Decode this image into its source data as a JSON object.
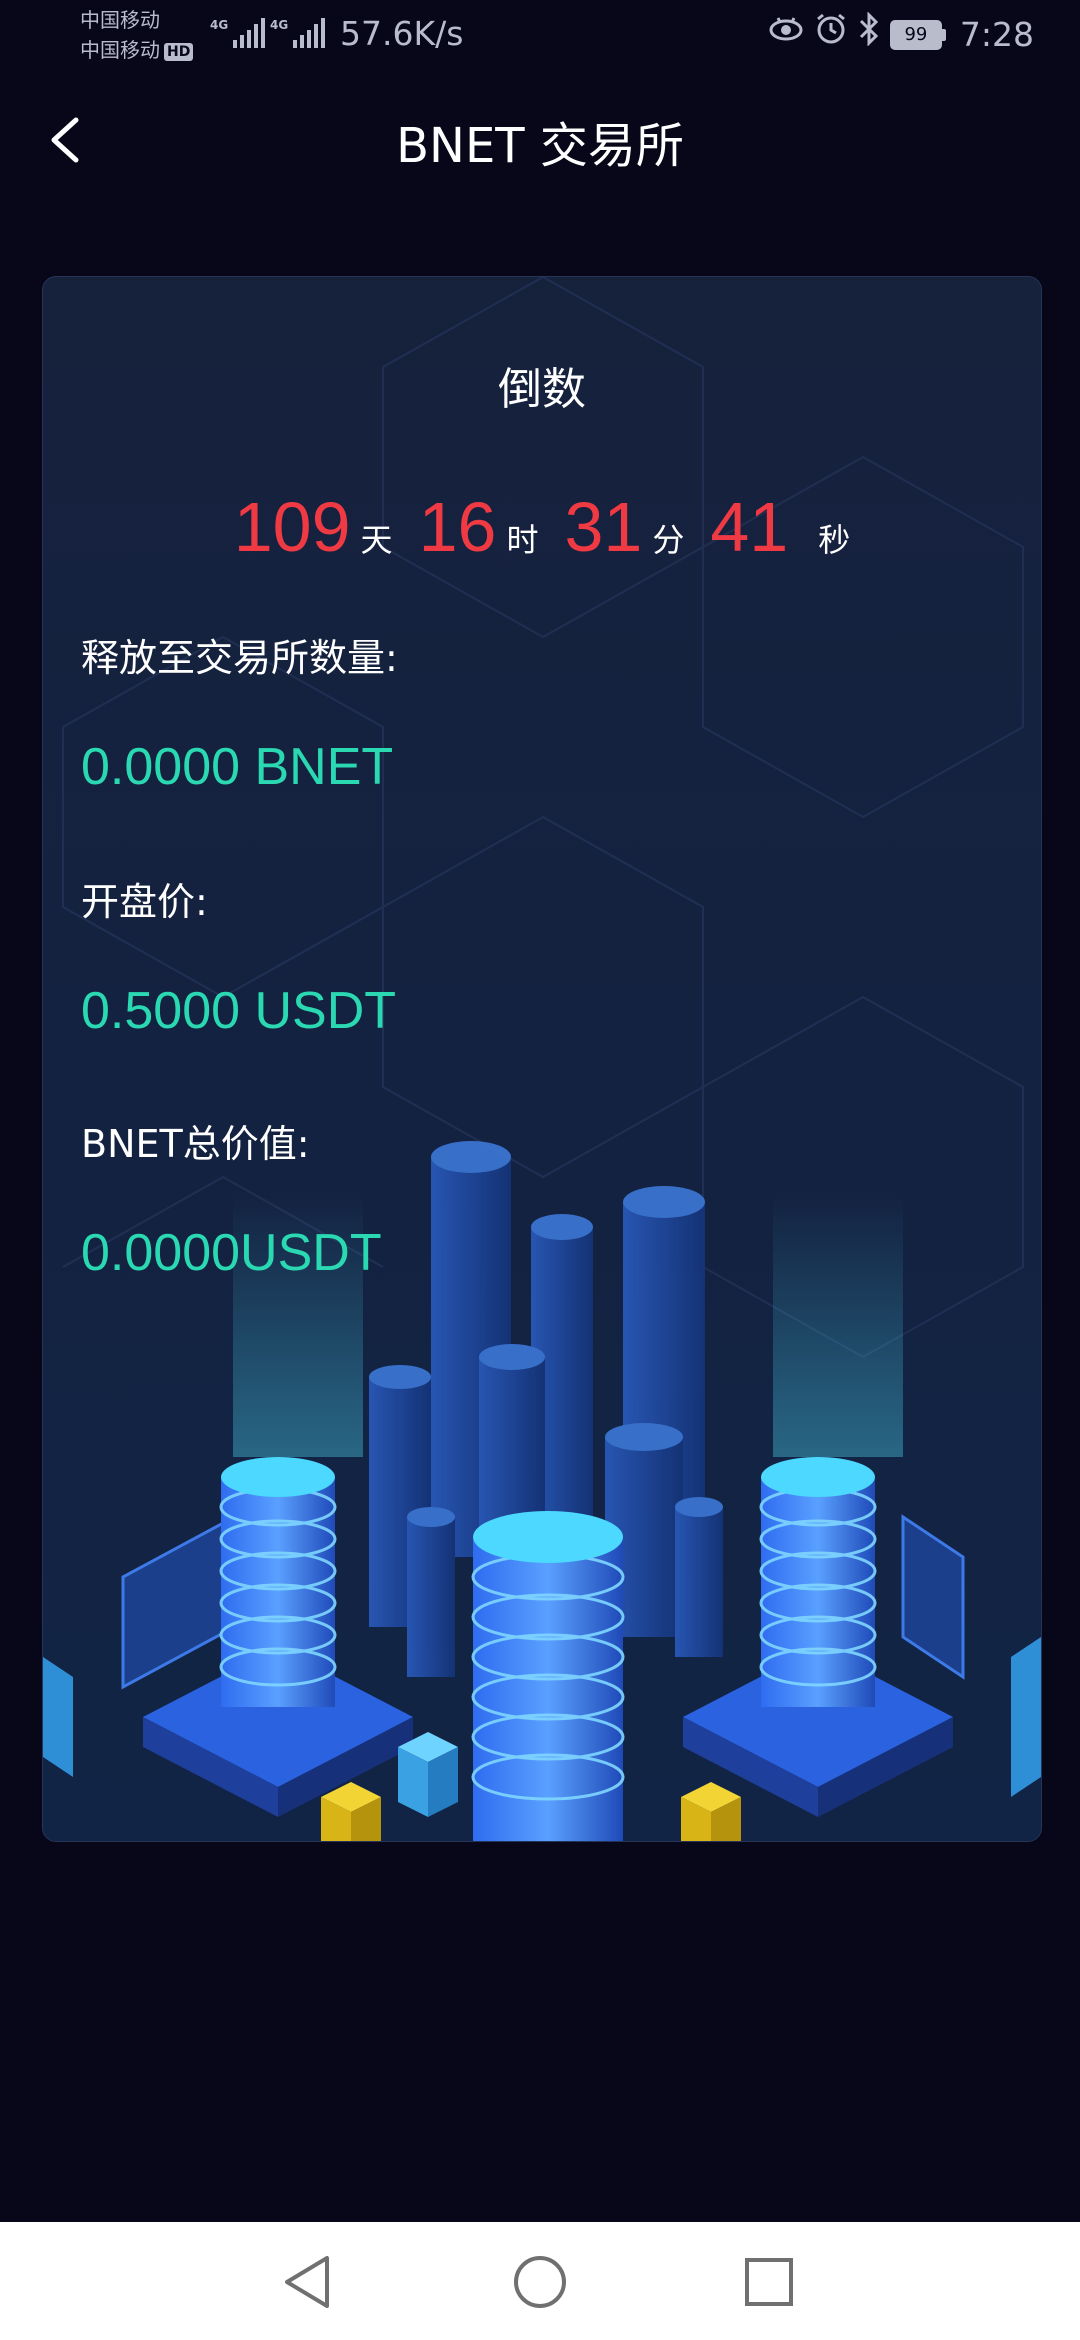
{
  "status_bar": {
    "carrier1": "中国移动",
    "carrier2": "中国移动",
    "hd": "HD",
    "sig1": "4G",
    "sig2": "4G",
    "speed": "57.6K/s",
    "battery": "99",
    "time": "7:28",
    "icons": [
      "eye-icon",
      "alarm-icon",
      "bluetooth-icon",
      "battery-icon"
    ]
  },
  "header": {
    "title": "BNET 交易所"
  },
  "card": {
    "countdown_title": "倒数",
    "countdown": {
      "days": "109",
      "days_unit": "天",
      "hours": "16",
      "hours_unit": "时",
      "minutes": "31",
      "minutes_unit": "分",
      "seconds": "41",
      "seconds_unit": "秒"
    },
    "release_label": "释放至交易所数量:",
    "release_value": "0.0000 BNET",
    "open_label": "开盘价:",
    "open_value": "0.5000 USDT",
    "total_label": "BNET总价值:",
    "total_value": "0.0000USDT"
  },
  "colors": {
    "background": "#070719",
    "countdown": "#ef3a44",
    "value": "#2ad9b2"
  }
}
